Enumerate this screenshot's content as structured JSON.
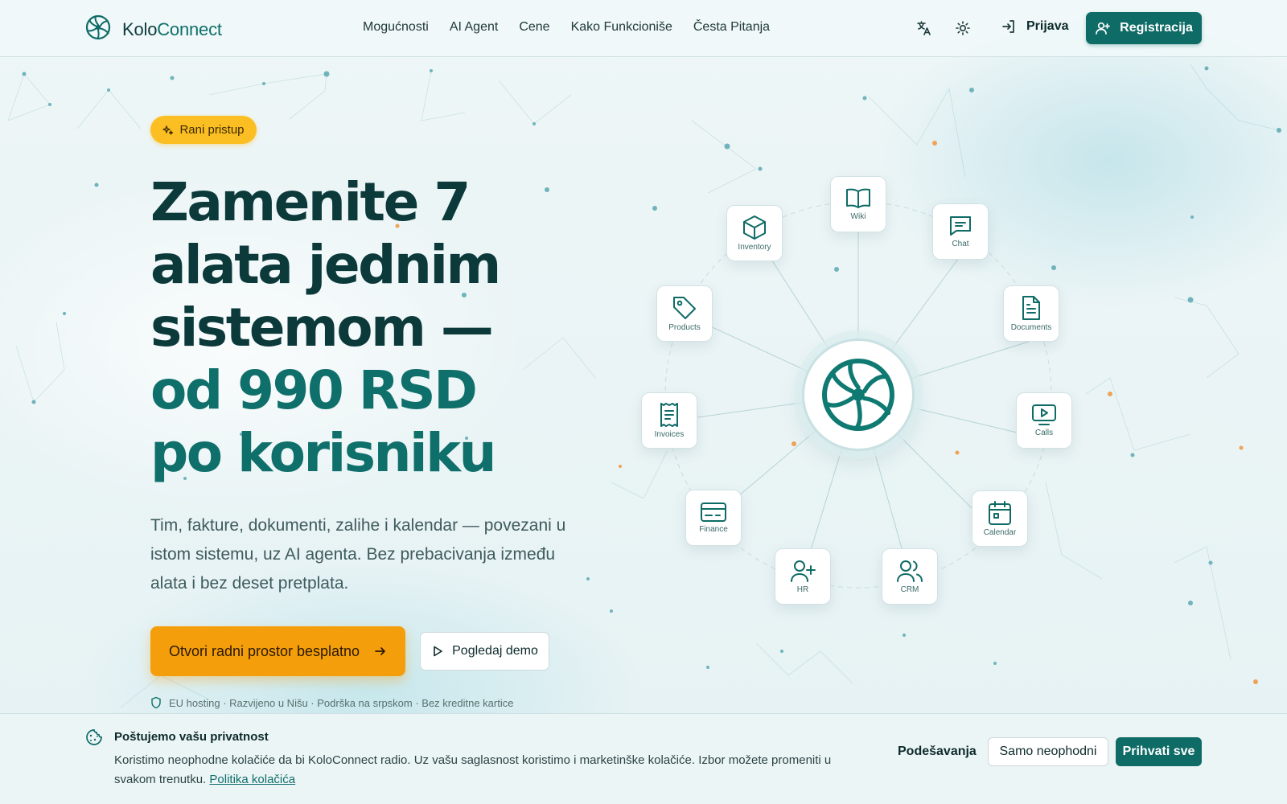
{
  "colors": {
    "brand": "#0f6b66",
    "headline_dark": "#0c3a3b",
    "headline_accent": "#0f6f6a",
    "cta_orange": "#f59e0b",
    "badge_yellow": "#fbbf24"
  },
  "nav": {
    "logo_prefix": "Kolo",
    "logo_suffix": "Connect",
    "links": [
      "Mogućnosti",
      "AI Agent",
      "Cene",
      "Kako Funkcioniše",
      "Česta Pitanja"
    ],
    "translate_icon": "translate-icon",
    "theme_icon": "sun-icon",
    "login_label": "Prijava",
    "register_label": "Registracija"
  },
  "hero": {
    "badge": "Rani pristup",
    "headline_dark": [
      "Zamenite 7",
      "alata jednim",
      "sistemom —"
    ],
    "headline_accent": [
      "od 990 RSD",
      "po korisniku"
    ],
    "subtitle": "Tim, fakture, dokumenti, zalihe i kalendar — povezani u istom sistemu, uz AI agenta. Bez prebacivanja između alata i bez deset pretplata.",
    "cta_primary": "Otvori radni prostor besplatno",
    "cta_secondary": "Pogledaj demo",
    "trust_line": "EU hosting · Razvijeno u Nišu · Podrška na srpskom · Bez kreditne kartice"
  },
  "hub": {
    "modules": [
      {
        "label": "Wiki",
        "icon": "book-icon"
      },
      {
        "label": "Chat",
        "icon": "message-icon"
      },
      {
        "label": "Documents",
        "icon": "document-icon"
      },
      {
        "label": "Calls",
        "icon": "video-icon"
      },
      {
        "label": "Calendar",
        "icon": "calendar-icon"
      },
      {
        "label": "CRM",
        "icon": "users-icon"
      },
      {
        "label": "HR",
        "icon": "user-plus-icon"
      },
      {
        "label": "Finance",
        "icon": "credit-card-icon"
      },
      {
        "label": "Invoices",
        "icon": "receipt-icon"
      },
      {
        "label": "Products",
        "icon": "tag-icon"
      },
      {
        "label": "Inventory",
        "icon": "box-icon"
      }
    ]
  },
  "cookie": {
    "title": "Poštujemo vašu privatnost",
    "text": "Koristimo neophodne kolačiće da bi KoloConnect radio. Uz vašu saglasnost koristimo i marketinške kolačiće. Izbor možete promeniti u svakom trenutku.",
    "link": "Politika kolačića",
    "settings_label": "Podešavanja",
    "necessary_label": "Samo neophodni",
    "accept_label": "Prihvati sve"
  }
}
